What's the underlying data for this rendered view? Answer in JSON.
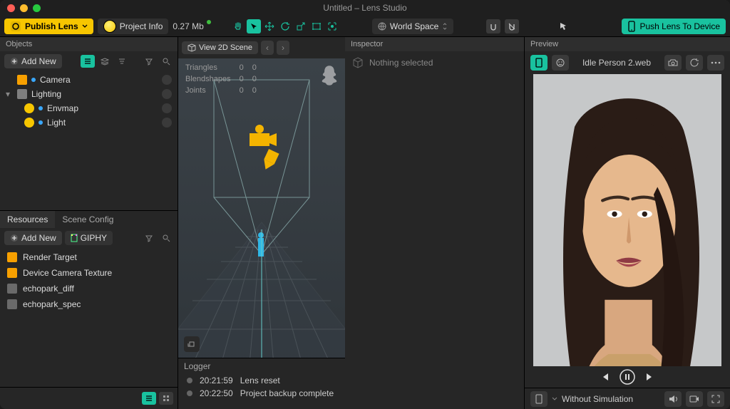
{
  "window": {
    "title": "Untitled – Lens Studio"
  },
  "toolbar": {
    "publish_label": "Publish Lens",
    "project_info_label": "Project Info",
    "file_size": "0.27 Mb",
    "world_space_label": "World Space",
    "push_label": "Push Lens To Device"
  },
  "objects": {
    "panel_title": "Objects",
    "add_label": "Add New",
    "items": [
      {
        "label": "Camera",
        "kind": "camera",
        "indent": 0,
        "expandable": false
      },
      {
        "label": "Lighting",
        "kind": "lighting",
        "indent": 0,
        "expandable": true
      },
      {
        "label": "Envmap",
        "kind": "light",
        "indent": 1,
        "expandable": false
      },
      {
        "label": "Light",
        "kind": "light",
        "indent": 1,
        "expandable": false
      }
    ]
  },
  "resources": {
    "tabs": [
      "Resources",
      "Scene Config"
    ],
    "add_label": "Add New",
    "giphy_label": "GIPHY",
    "items": [
      {
        "label": "Render Target",
        "icon": "orange"
      },
      {
        "label": "Device Camera Texture",
        "icon": "orange"
      },
      {
        "label": "echopark_diff",
        "icon": "grey"
      },
      {
        "label": "echopark_spec",
        "icon": "grey"
      }
    ]
  },
  "viewport": {
    "view_label": "View 2D Scene",
    "stats": {
      "triangles_label": "Triangles",
      "triangles_a": 0,
      "triangles_b": 0,
      "blendshapes_label": "Blendshapes",
      "blendshapes_a": 0,
      "blendshapes_b": 0,
      "joints_label": "Joints",
      "joints_a": 0,
      "joints_b": 0
    }
  },
  "logger": {
    "title": "Logger",
    "rows": [
      {
        "time": "20:21:59",
        "msg": "Lens reset"
      },
      {
        "time": "20:22:50",
        "msg": "Project backup complete"
      }
    ]
  },
  "inspector": {
    "title": "Inspector",
    "empty_text": "Nothing selected"
  },
  "preview": {
    "title": "Preview",
    "clip_name": "Idle Person 2.web",
    "simulation_label": "Without Simulation"
  }
}
